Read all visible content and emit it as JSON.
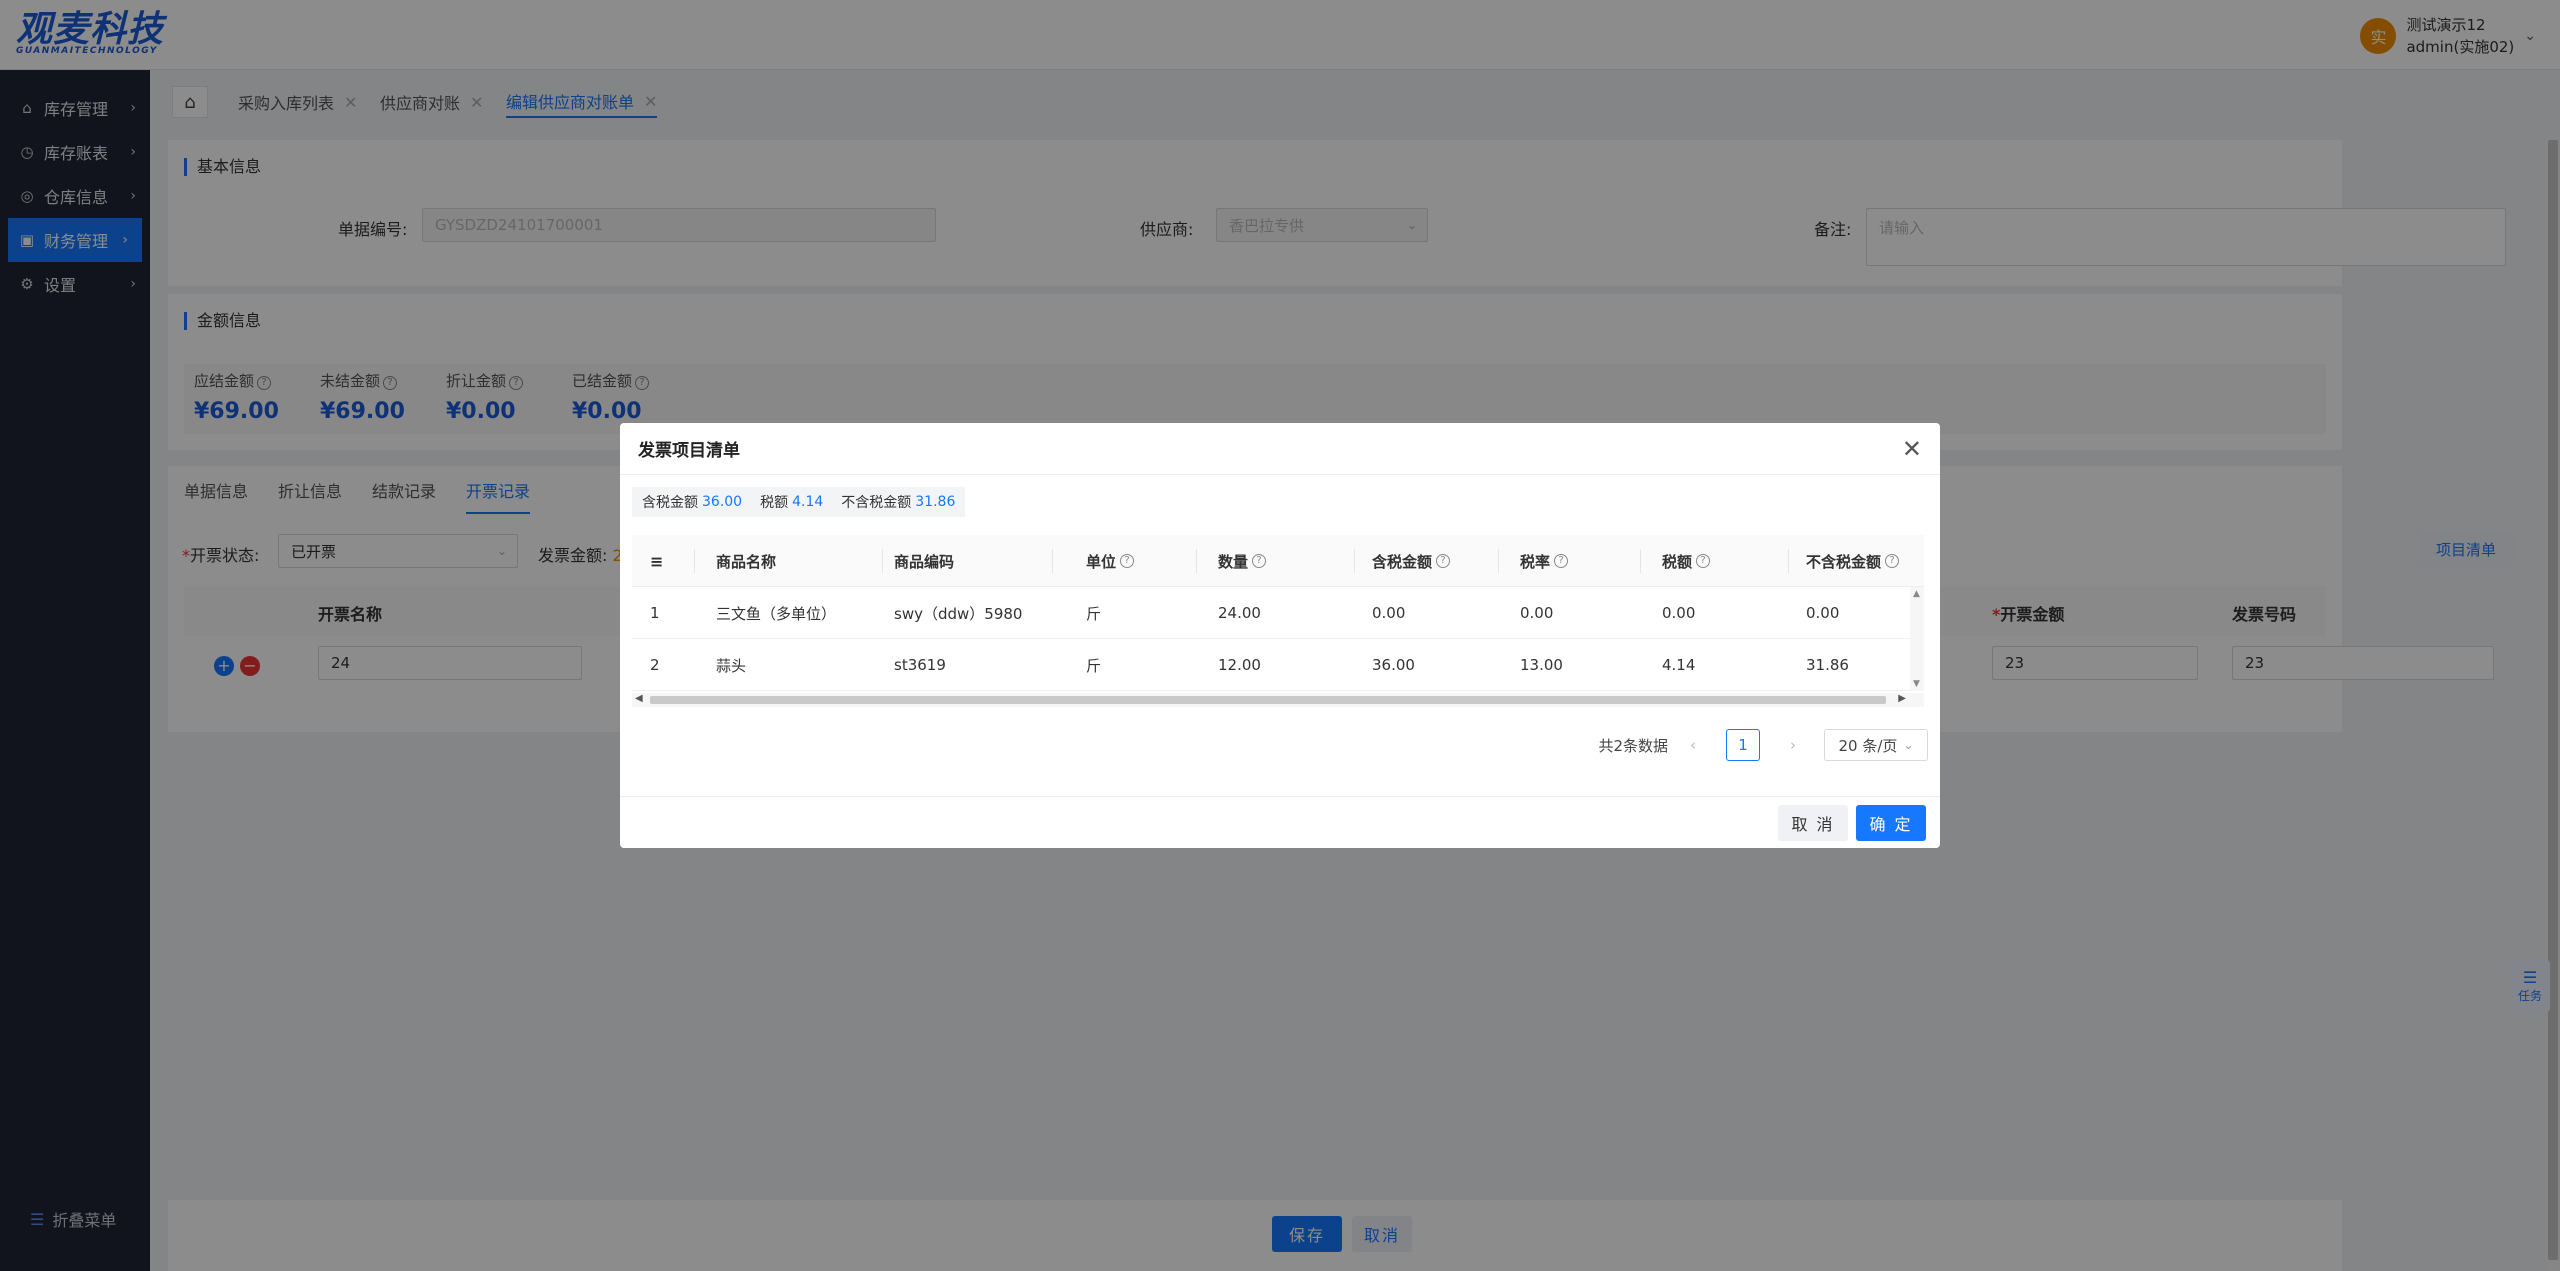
{
  "brand": {
    "logo_cn": "观麦科技",
    "logo_en": "GUANMAITECHNOLOGY"
  },
  "user": {
    "avatar_char": "实",
    "name": "测试演示12",
    "account": "admin(实施02)"
  },
  "sidebar": {
    "items": [
      {
        "label": "库存管理",
        "icon": "home-icon"
      },
      {
        "label": "库存账表",
        "icon": "chart-pie-icon"
      },
      {
        "label": "仓库信息",
        "icon": "warehouse-icon"
      },
      {
        "label": "财务管理",
        "icon": "finance-icon",
        "active": true
      },
      {
        "label": "设置",
        "icon": "gear-icon"
      }
    ],
    "collapse_label": "折叠菜单"
  },
  "tabs": [
    "采购入库列表",
    "供应商对账",
    "编辑供应商对账单"
  ],
  "basic": {
    "title": "基本信息",
    "order_no_label": "单据编号:",
    "order_no_value": "GYSDZD24101700001",
    "supplier_label": "供应商:",
    "supplier_value": "香巴拉专供",
    "remark_label": "备注:",
    "remark_placeholder": "请输入"
  },
  "amount": {
    "title": "金额信息",
    "items": [
      {
        "label": "应结金额",
        "value": "¥69.00"
      },
      {
        "label": "未结金额",
        "value": "¥69.00"
      },
      {
        "label": "折让金额",
        "value": "¥0.00"
      },
      {
        "label": "已结金额",
        "value": "¥0.00"
      }
    ]
  },
  "subtabs": [
    "单据信息",
    "折让信息",
    "结款记录",
    "开票记录"
  ],
  "invoice": {
    "status_label": "开票状态:",
    "status_value": "已开票",
    "amount_label": "发票金额:",
    "amount_value_partial": "2",
    "item_list_button": "项目清单",
    "col_name": "开票名称",
    "col_amount": "开票金额",
    "col_number": "发票号码",
    "row_name": "24",
    "row_amount": "23",
    "row_number": "23"
  },
  "footer": {
    "save": "保存",
    "cancel": "取消"
  },
  "task_label": "任务",
  "modal": {
    "title": "发票项目清单",
    "summary": [
      {
        "label": "含税金额",
        "value": "36.00"
      },
      {
        "label": "税额",
        "value": "4.14"
      },
      {
        "label": "不含税金额",
        "value": "31.86"
      }
    ],
    "columns": [
      "商品名称",
      "商品编码",
      "单位",
      "数量",
      "含税金额",
      "税率",
      "税额",
      "不含税金额"
    ],
    "rows": [
      {
        "idx": "1",
        "name": "三文鱼（多单位）",
        "code": "swy（ddw）5980",
        "unit": "斤",
        "qty": "24.00",
        "tax_amount": "0.00",
        "rate": "0.00",
        "tax": "0.00",
        "net": "0.00"
      },
      {
        "idx": "2",
        "name": "蒜头",
        "code": "st3619",
        "unit": "斤",
        "qty": "12.00",
        "tax_amount": "36.00",
        "rate": "13.00",
        "tax": "4.14",
        "net": "31.86"
      }
    ],
    "total_text": "共2条数据",
    "current_page": "1",
    "page_size": "20 条/页",
    "cancel": "取 消",
    "ok": "确 定"
  }
}
